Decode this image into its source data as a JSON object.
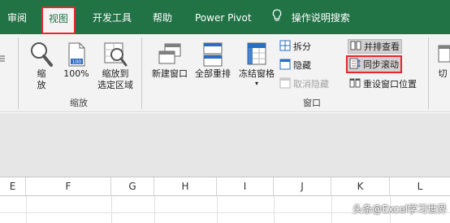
{
  "tabs": [
    {
      "label": "审阅",
      "active": false
    },
    {
      "label": "视图",
      "active": true
    },
    {
      "label": "开发工具",
      "active": false
    },
    {
      "label": "帮助",
      "active": false
    },
    {
      "label": "Power Pivot",
      "active": false
    },
    {
      "label": "操作说明搜索",
      "active": false
    }
  ],
  "ribbon": {
    "zoom_group": {
      "label": "缩放",
      "buttons": [
        {
          "label_line1": "缩",
          "label_line2": "放",
          "icon": "magnifier-icon"
        },
        {
          "label_line1": "100%",
          "label_line2": "",
          "icon": "page-100-icon"
        },
        {
          "label_line1": "缩放到",
          "label_line2": "选定区域",
          "icon": "zoom-selection-icon"
        }
      ]
    },
    "window_group": {
      "label": "窗口",
      "buttons": [
        {
          "label": "新建窗口",
          "icon": "new-window-icon"
        },
        {
          "label": "全部重排",
          "icon": "arrange-all-icon"
        },
        {
          "label": "冻结窗格",
          "icon": "freeze-panes-icon",
          "has_dropdown": true
        }
      ],
      "small_buttons": [
        {
          "label": "拆分",
          "icon": "split-icon",
          "disabled": false
        },
        {
          "label": "隐藏",
          "icon": "hide-icon",
          "disabled": false
        },
        {
          "label": "取消隐藏",
          "icon": "unhide-icon",
          "disabled": true
        }
      ],
      "compare_buttons": [
        {
          "label": "并排查看",
          "icon": "side-by-side-icon",
          "pressed": true,
          "highlighted": false
        },
        {
          "label": "同步滚动",
          "icon": "sync-scroll-icon",
          "pressed": true,
          "highlighted": true
        },
        {
          "label": "重设窗口位置",
          "icon": "reset-position-icon",
          "pressed": false,
          "highlighted": false
        }
      ],
      "partial_button": {
        "label": "切"
      }
    }
  },
  "columns": [
    "E",
    "F",
    "G",
    "H",
    "I",
    "J",
    "K",
    "L"
  ],
  "watermark": "头条@Excel学习世界",
  "colors": {
    "accent": "#217346",
    "highlight": "#e8262c",
    "ribbon_bg": "#f3f3f3"
  }
}
